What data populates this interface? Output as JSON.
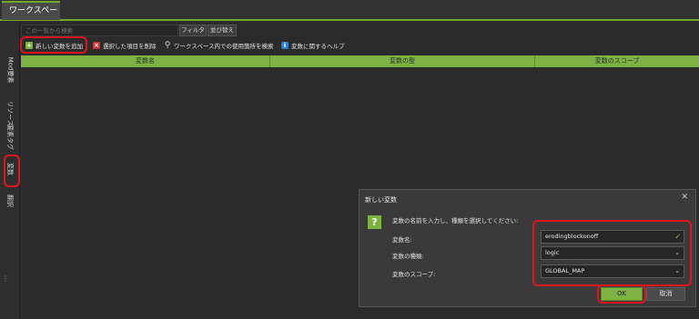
{
  "tabs": {
    "active": "ワークスペース"
  },
  "rail": {
    "items": [
      "Mod要素",
      "リソース",
      "要素タグ",
      "変数",
      "翻訳"
    ]
  },
  "search": {
    "placeholder": "この一覧から検索",
    "filter_label": "フィルタ",
    "sort_label": "並び替え"
  },
  "toolbar": {
    "add_label": "新しい変数を追加",
    "delete_label": "選択した項目を削除",
    "find_usage_label": "ワークスペース内での使用箇所を検索",
    "help_label": "変数に関するヘルプ"
  },
  "table": {
    "columns": [
      "変数名",
      "変数の型",
      "変数のスコープ"
    ]
  },
  "dialog": {
    "title": "新しい変数",
    "message": "変数の名前を入力し、種類を選択してください:",
    "name_label": "変数名:",
    "name_value": "erodingblockonoff",
    "type_label": "変数の種類:",
    "type_value": "logic",
    "scope_label": "変数のスコープ:",
    "scope_value": "GLOBAL_MAP",
    "ok_label": "OK",
    "cancel_label": "取消"
  },
  "colors": {
    "accent": "#7cb342",
    "highlight": "#e0141e",
    "background": "#2b2b2b"
  }
}
